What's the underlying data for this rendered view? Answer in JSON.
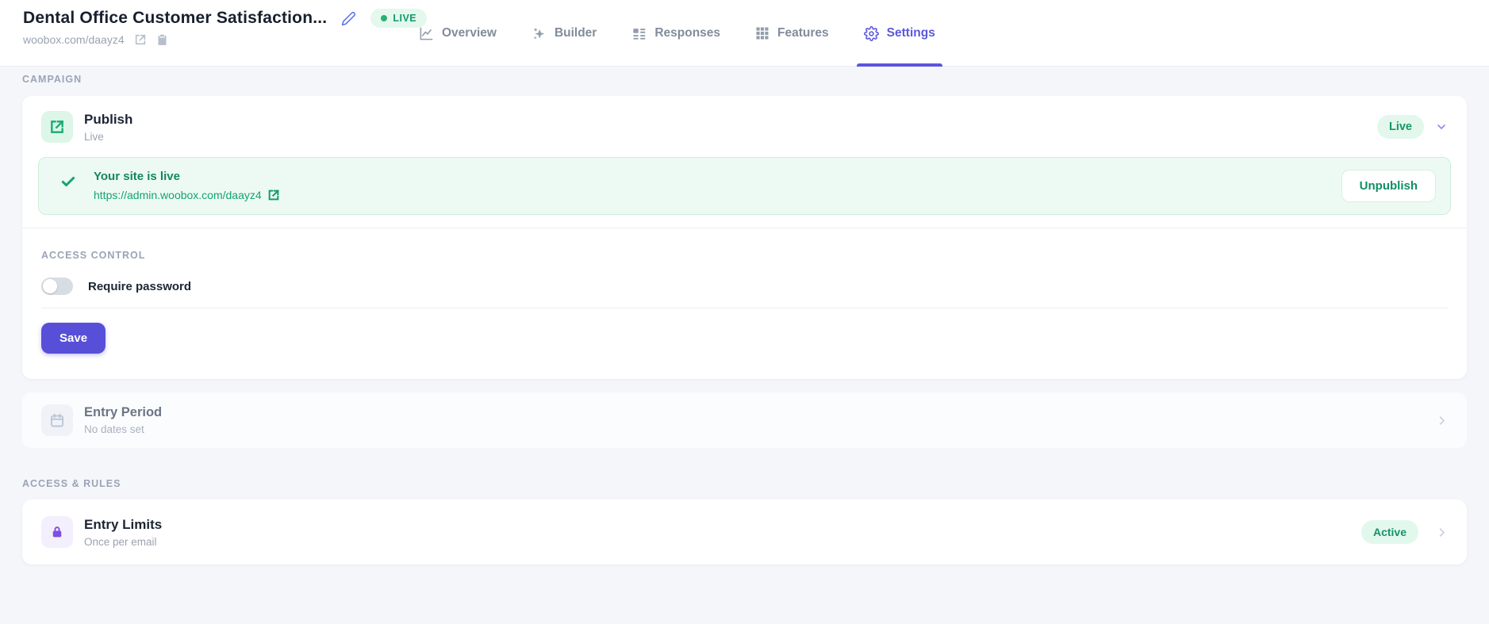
{
  "colors": {
    "accent_indigo": "#574fd8",
    "success_green": "#13996a",
    "success_bg": "#e4f8ee",
    "alert_bg": "#edfaf3",
    "page_bg": "#f5f6fa",
    "purple_icon": "#7e4fe3"
  },
  "header": {
    "title": "Dental Office Customer Satisfaction...",
    "live_badge": "LIVE",
    "url": "woobox.com/daayz4",
    "nav": {
      "active": "Settings",
      "items": [
        {
          "label": "Overview",
          "icon": "line-chart-icon"
        },
        {
          "label": "Builder",
          "icon": "sparkles-icon"
        },
        {
          "label": "Responses",
          "icon": "list-details-icon"
        },
        {
          "label": "Features",
          "icon": "grid-icon"
        },
        {
          "label": "Settings",
          "icon": "gear-icon"
        }
      ]
    }
  },
  "campaign_section": {
    "label": "CAMPAIGN",
    "publish": {
      "title": "Publish",
      "subtitle": "Live",
      "status_badge": "Live",
      "icon": "external-link-icon"
    },
    "site_alert": {
      "title": "Your site is live",
      "url": "https://admin.woobox.com/daayz4",
      "unpublish_label": "Unpublish",
      "icon": "checkmark-icon"
    },
    "access_control": {
      "label": "ACCESS CONTROL",
      "toggle_label": "Require password",
      "toggle_state": "off",
      "save_label": "Save"
    },
    "entry_period": {
      "title": "Entry Period",
      "subtitle": "No dates set",
      "icon": "calendar-icon"
    }
  },
  "access_rules_section": {
    "label": "ACCESS & RULES",
    "entry_limits": {
      "title": "Entry Limits",
      "subtitle": "Once per email",
      "status_badge": "Active",
      "icon": "lock-icon"
    }
  }
}
